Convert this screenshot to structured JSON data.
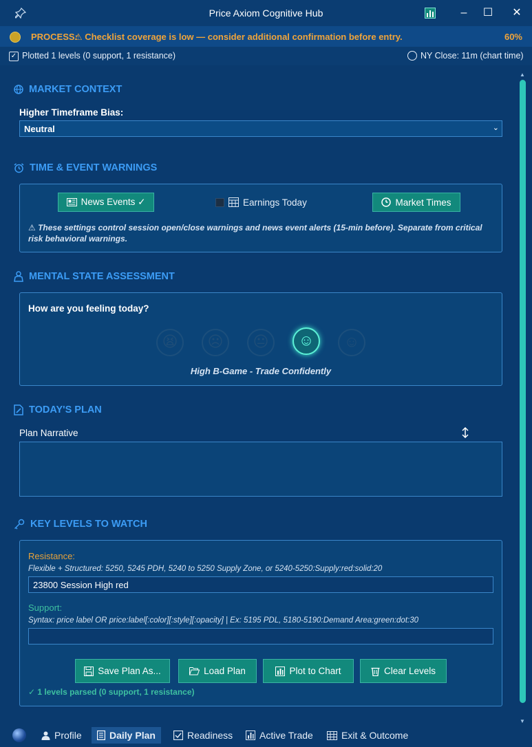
{
  "window": {
    "title": "Price Axiom Cognitive Hub",
    "pin_icon": "pin-icon",
    "chart_icon": "bar-chart-icon",
    "minimize": "–",
    "maximize": "☐",
    "close": "✕"
  },
  "process": {
    "label": "PROCESS:",
    "message": "⚠ Checklist coverage is low — consider additional confirmation before entry.",
    "percent": "60%"
  },
  "status": {
    "plotted": "Plotted 1 levels (0 support, 1 resistance)",
    "ny_close": "NY Close: 11m (chart time)"
  },
  "market_context": {
    "heading": "MARKET CONTEXT",
    "bias_label": "Higher Timeframe Bias:",
    "bias_value": "Neutral"
  },
  "time_events": {
    "heading": "TIME & EVENT WARNINGS",
    "news_button": "News Events ✓",
    "earnings_label": "Earnings Today",
    "market_times_button": "Market Times",
    "note": "⚠ These settings control session open/close warnings and news event alerts (15-min before). Separate from critical risk behavioral warnings."
  },
  "mental_state": {
    "heading": "MENTAL STATE ASSESSMENT",
    "question": "How are you feeling today?",
    "selected_caption": "High B-Game - Trade Confidently",
    "options": [
      "exhausted",
      "sad",
      "neutral",
      "confident",
      "happy"
    ],
    "selected_index": 3
  },
  "todays_plan": {
    "heading": "TODAY'S PLAN",
    "narrative_label": "Plan Narrative",
    "narrative_value": ""
  },
  "key_levels": {
    "heading": "KEY LEVELS TO WATCH",
    "resistance_label": "Resistance:",
    "resistance_hint": "Flexible + Structured: 5250, 5245 PDH, 5240 to 5250 Supply Zone, or 5240-5250:Supply:red:solid:20",
    "resistance_value": "23800 Session High red",
    "support_label": "Support:",
    "support_hint": "Syntax: price label OR price:label[:color][:style][:opacity]  |  Ex: 5195 PDL, 5180-5190:Demand Area:green:dot:30",
    "support_value": "",
    "save_button": "Save Plan As...",
    "load_button": "Load Plan",
    "plot_button": "Plot to Chart",
    "clear_button": "Clear Levels",
    "parse_status": "✓ 1 levels parsed (0 support, 1 resistance)"
  },
  "tabs": [
    {
      "label": "Profile"
    },
    {
      "label": "Daily Plan"
    },
    {
      "label": "Readiness"
    },
    {
      "label": "Active Trade"
    },
    {
      "label": "Exit & Outcome"
    }
  ],
  "colors": {
    "background": "#0a3a6e",
    "accent_blue": "#3c9cf5",
    "teal": "#12897c",
    "warning_orange": "#f0a43a"
  }
}
